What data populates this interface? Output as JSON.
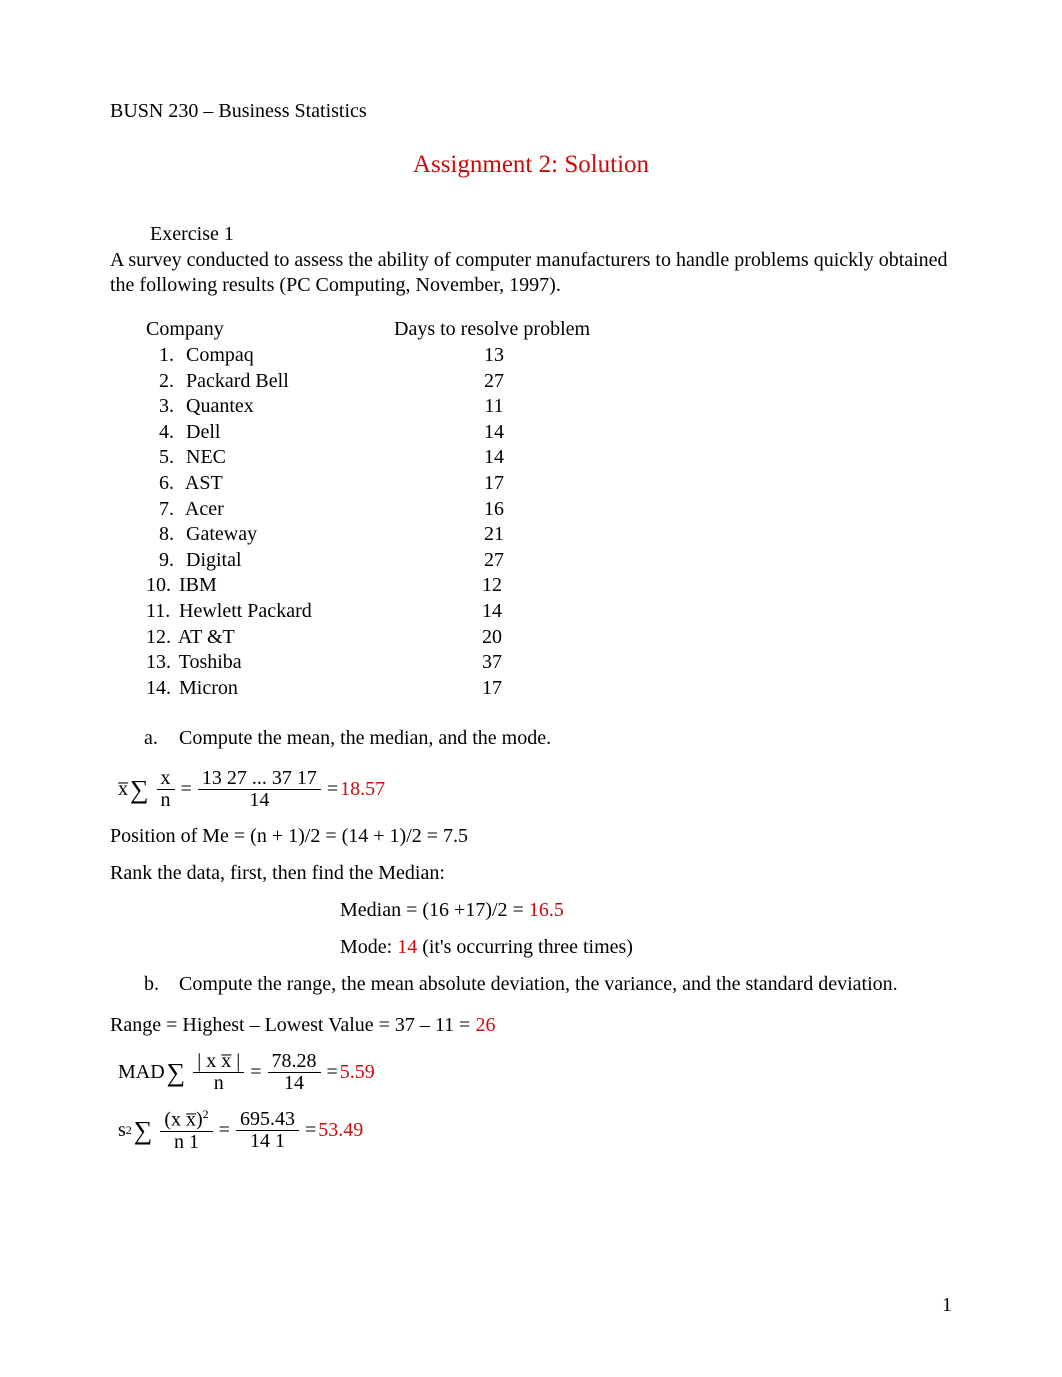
{
  "course_header": "BUSN 230 – Business Statistics",
  "title": "Assignment 2: Solution",
  "exercise_label": "Exercise 1",
  "intro": "A survey conducted to assess the ability of computer manufacturers to handle problems quickly obtained the following results (PC Computing, November, 1997).",
  "table": {
    "header_company": "Company",
    "header_days": "Days to resolve problem",
    "rows": [
      {
        "n": "1.",
        "name": "Compaq",
        "days": "13"
      },
      {
        "n": "2.",
        "name": "Packard Bell",
        "days": "27"
      },
      {
        "n": "3.",
        "name": "Quantex",
        "days": "11"
      },
      {
        "n": "4.",
        "name": "Dell",
        "days": "14"
      },
      {
        "n": "5.",
        "name": "NEC",
        "days": "14"
      },
      {
        "n": "6.",
        "name": "AST",
        "days": "17"
      },
      {
        "n": "7.",
        "name": "Acer",
        "days": "16"
      },
      {
        "n": "8.",
        "name": "Gateway",
        "days": "21"
      },
      {
        "n": "9.",
        "name": "Digital",
        "days": "27"
      },
      {
        "n": "10.",
        "name": "IBM",
        "days": "12"
      },
      {
        "n": "11.",
        "name": "Hewlett Packard",
        "days": "14"
      },
      {
        "n": "12.",
        "name": "AT &T",
        "days": "20"
      },
      {
        "n": "13.",
        "name": "Toshiba",
        "days": "37"
      },
      {
        "n": "14.",
        "name": "Micron",
        "days": "17"
      }
    ]
  },
  "qa": {
    "letter": "a.",
    "text": "Compute the mean, the median, and the mode."
  },
  "mean": {
    "lhs": "x̅ ",
    "sum_sym": "∑",
    "num1": "x",
    "den1": "n",
    "eq1": "=",
    "num2": "13  27  ...  37  17",
    "den2": "14",
    "eq2": "=",
    "result": "18.57"
  },
  "median_pos": "Position of Me = (n + 1)/2 = (14 + 1)/2 = 7.5",
  "rank_text": "Rank the data, first, then find the Median:",
  "median_line_pre": "Median = (16 +17)/2 = ",
  "median_value": "16.5",
  "mode_pre": "Mode: ",
  "mode_value": "14",
  "mode_post": " (it's occurring three times)",
  "qb": {
    "letter": "b.",
    "text": "Compute the range, the mean absolute deviation, the variance, and the standard deviation."
  },
  "range_pre": "Range = Highest – Lowest Value = 37 – 11 =  ",
  "range_value": "26",
  "mad": {
    "label": "MAD",
    "sum_sym": "∑",
    "num1": "| x  x̅ |",
    "den1": "n",
    "eq1": "=",
    "num2": "78.28",
    "den2": "14",
    "eq2": "=",
    "result": "5.59"
  },
  "var": {
    "label": "s",
    "sup": "2",
    "sum_sym": "∑",
    "num1_pre": "(x  x̅)",
    "num1_sup": "2",
    "den1": "n  1",
    "eq1": "=",
    "num2": "695.43",
    "den2": "14  1",
    "eq2": "=",
    "result": "53.49"
  },
  "page_number": "1"
}
